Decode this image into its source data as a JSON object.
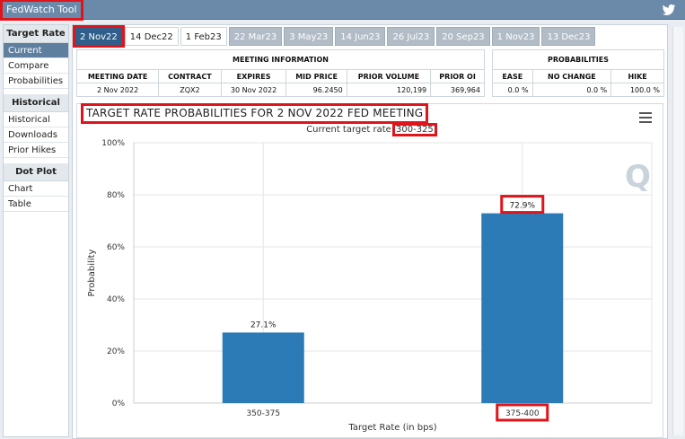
{
  "app": {
    "title": "FedWatch Tool",
    "colors": {
      "header": "#6b89a8",
      "active_tab": "#2f5f8a",
      "bar": "#2c7bb6",
      "highlight": "#e0141b"
    }
  },
  "sidebar": {
    "groups": [
      {
        "title": "Target Rate",
        "items": [
          "Current",
          "Compare",
          "Probabilities"
        ],
        "active": "Current"
      },
      {
        "title": "Historical",
        "items": [
          "Historical",
          "Downloads",
          "Prior Hikes"
        ]
      },
      {
        "title": "Dot Plot",
        "items": [
          "Chart",
          "Table"
        ]
      }
    ]
  },
  "tabs": [
    "2 Nov22",
    "14 Dec22",
    "1 Feb23",
    "22 Mar23",
    "3 May23",
    "14 Jun23",
    "26 Jul23",
    "20 Sep23",
    "1 Nov23",
    "13 Dec23"
  ],
  "active_tab": "2 Nov22",
  "meeting_info": {
    "title": "MEETING INFORMATION",
    "headers": [
      "MEETING DATE",
      "CONTRACT",
      "EXPIRES",
      "MID PRICE",
      "PRIOR VOLUME",
      "PRIOR OI"
    ],
    "row": [
      "2 Nov 2022",
      "ZQX2",
      "30 Nov 2022",
      "96.2450",
      "120,199",
      "369,964"
    ]
  },
  "probabilities": {
    "title": "PROBABILITIES",
    "headers": [
      "EASE",
      "NO CHANGE",
      "HIKE"
    ],
    "row": [
      "0.0 %",
      "0.0 %",
      "100.0 %"
    ]
  },
  "chart": {
    "title": "TARGET RATE PROBABILITIES FOR 2 NOV 2022 FED MEETING",
    "subtitle_label": "Current target rate",
    "subtitle_value": "300-325",
    "watermark": "Q"
  },
  "chart_data": {
    "type": "bar",
    "categories": [
      "350-375",
      "375-400"
    ],
    "values": [
      27.1,
      72.9
    ],
    "value_labels": [
      "27.1%",
      "72.9%"
    ],
    "xlabel": "Target Rate (in bps)",
    "ylabel": "Probability",
    "ylim": [
      0,
      100
    ],
    "yticks": [
      "0%",
      "20%",
      "40%",
      "60%",
      "80%",
      "100%"
    ],
    "grid": true
  }
}
